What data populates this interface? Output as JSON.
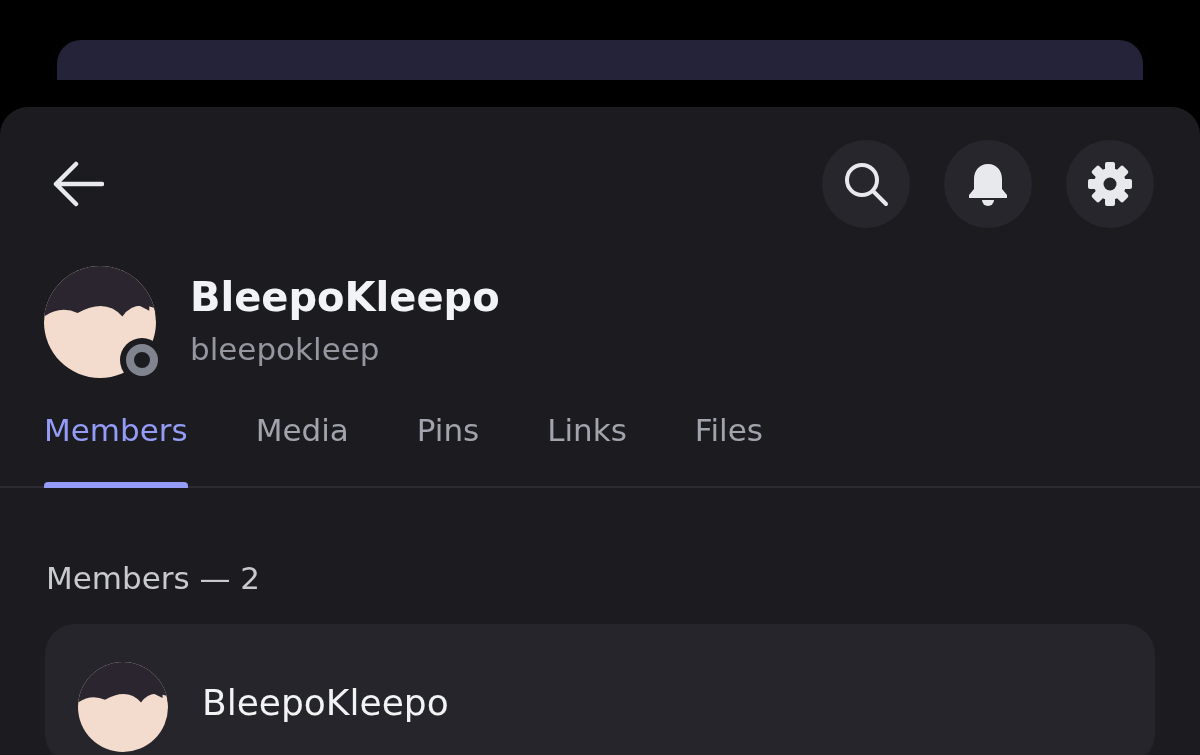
{
  "profile": {
    "display_name": "BleepoKleepo",
    "username": "bleepokleep",
    "online": false
  },
  "tabs": [
    {
      "label": "Members",
      "selected": true
    },
    {
      "label": "Media",
      "selected": false
    },
    {
      "label": "Pins",
      "selected": false
    },
    {
      "label": "Links",
      "selected": false
    },
    {
      "label": "Files",
      "selected": false
    }
  ],
  "members_heading": "Members — 2",
  "members": [
    {
      "name": "BleepoKleepo"
    }
  ]
}
